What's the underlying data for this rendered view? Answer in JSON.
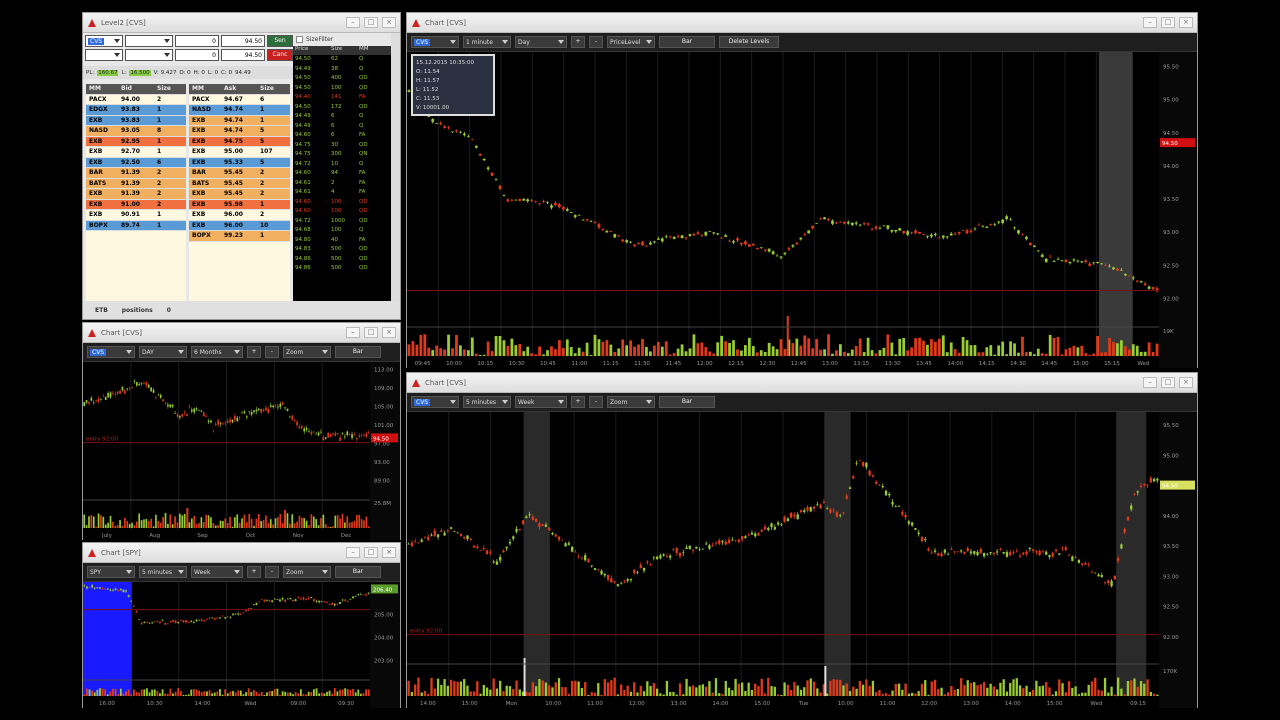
{
  "level2": {
    "title": "Level2 [CVS]",
    "send": "Sen",
    "cancel": "Canc",
    "inputs": [
      "0",
      "94.50",
      "0",
      "94.50"
    ],
    "price_bar": {
      "pl": "160.67",
      "l": "16.500",
      "v": "V: 9.427",
      "o": "O:  0",
      "h": "H:  0",
      "l2": "L:  0",
      "c": "C: 0",
      "last": "94.49"
    },
    "bid_headers": [
      "MM",
      "Bid",
      "Size"
    ],
    "ask_headers": [
      "MM",
      "Ask",
      "Size"
    ],
    "bids": [
      {
        "mm": "PACX",
        "p": "94.00",
        "s": "2",
        "c": "#fff8e0"
      },
      {
        "mm": "EDGX",
        "p": "93.83",
        "s": "1",
        "c": "#5b9bd5"
      },
      {
        "mm": "EXB",
        "p": "93.83",
        "s": "1",
        "c": "#5b9bd5"
      },
      {
        "mm": "NASD",
        "p": "93.05",
        "s": "8",
        "c": "#f0b060"
      },
      {
        "mm": "EXB",
        "p": "92.95",
        "s": "1",
        "c": "#f07040"
      },
      {
        "mm": "EXB",
        "p": "92.70",
        "s": "1",
        "c": "#fff8e0"
      },
      {
        "mm": "EXB",
        "p": "92.50",
        "s": "6",
        "c": "#5b9bd5"
      },
      {
        "mm": "BAR",
        "p": "91.39",
        "s": "2",
        "c": "#f0b060"
      },
      {
        "mm": "BATS",
        "p": "91.39",
        "s": "2",
        "c": "#f0b060"
      },
      {
        "mm": "EXB",
        "p": "91.39",
        "s": "2",
        "c": "#f0b060"
      },
      {
        "mm": "EXB",
        "p": "91.00",
        "s": "2",
        "c": "#f07040"
      },
      {
        "mm": "EXB",
        "p": "90.91",
        "s": "1",
        "c": "#fff8e0"
      },
      {
        "mm": "BOPX",
        "p": "89.74",
        "s": "1",
        "c": "#5b9bd5"
      }
    ],
    "asks": [
      {
        "mm": "PACX",
        "p": "94.67",
        "s": "6",
        "c": "#fff8e0"
      },
      {
        "mm": "NASD",
        "p": "94.74",
        "s": "1",
        "c": "#5b9bd5"
      },
      {
        "mm": "EXB",
        "p": "94.74",
        "s": "1",
        "c": "#f0b060"
      },
      {
        "mm": "EXB",
        "p": "94.74",
        "s": "5",
        "c": "#f0b060"
      },
      {
        "mm": "EXB",
        "p": "94.75",
        "s": "5",
        "c": "#f07040"
      },
      {
        "mm": "EXB",
        "p": "95.00",
        "s": "107",
        "c": "#fff8e0"
      },
      {
        "mm": "EXB",
        "p": "95.33",
        "s": "5",
        "c": "#5b9bd5"
      },
      {
        "mm": "BAR",
        "p": "95.45",
        "s": "2",
        "c": "#f0b060"
      },
      {
        "mm": "BATS",
        "p": "95.45",
        "s": "2",
        "c": "#f0b060"
      },
      {
        "mm": "EXB",
        "p": "95.45",
        "s": "2",
        "c": "#f0b060"
      },
      {
        "mm": "EXB",
        "p": "95.98",
        "s": "1",
        "c": "#f07040"
      },
      {
        "mm": "EXB",
        "p": "96.00",
        "s": "2",
        "c": "#fff8e0"
      },
      {
        "mm": "EXB",
        "p": "96.00",
        "s": "10",
        "c": "#5b9bd5"
      },
      {
        "mm": "BOPX",
        "p": "99.23",
        "s": "1",
        "c": "#f0b060"
      }
    ],
    "sizefilter": "SizeFilter",
    "ts_headers": [
      "Price",
      "Size",
      "MM"
    ],
    "ts": [
      {
        "p": "94.50",
        "s": "62",
        "m": "Q"
      },
      {
        "p": "94.49",
        "s": "38",
        "m": "Q"
      },
      {
        "p": "94.50",
        "s": "400",
        "m": "QD"
      },
      {
        "p": "94.50",
        "s": "100",
        "m": "QD"
      },
      {
        "p": "94.40",
        "s": "141",
        "m": "FA"
      },
      {
        "p": "94.50",
        "s": "172",
        "m": "QD"
      },
      {
        "p": "94.49",
        "s": "6",
        "m": "Q"
      },
      {
        "p": "94.49",
        "s": "6",
        "m": "Q"
      },
      {
        "p": "94.60",
        "s": "6",
        "m": "FA"
      },
      {
        "p": "94.75",
        "s": "30",
        "m": "QD"
      },
      {
        "p": "94.75",
        "s": "300",
        "m": "QN"
      },
      {
        "p": "94.72",
        "s": "10",
        "m": "Q"
      },
      {
        "p": "94.60",
        "s": "94",
        "m": "FA"
      },
      {
        "p": "94.61",
        "s": "2",
        "m": "FA"
      },
      {
        "p": "94.61",
        "s": "4",
        "m": "FA"
      },
      {
        "p": "94.60",
        "s": "100",
        "m": "QD"
      },
      {
        "p": "94.60",
        "s": "100",
        "m": "QD"
      },
      {
        "p": "94.72",
        "s": "1000",
        "m": "QD"
      },
      {
        "p": "94.68",
        "s": "100",
        "m": "Q"
      },
      {
        "p": "94.80",
        "s": "40",
        "m": "FA"
      },
      {
        "p": "94.83",
        "s": "500",
        "m": "QD"
      },
      {
        "p": "94.86",
        "s": "500",
        "m": "QD"
      },
      {
        "p": "94.86",
        "s": "500",
        "m": "QD"
      }
    ],
    "footer_label": "ETB",
    "positions_label": "positions",
    "positions_value": "0"
  },
  "chart_daily": {
    "title": "Chart [CVS]",
    "symbol": "CVS",
    "interval": "DAY",
    "range": "6 Months",
    "zoom": "Zoom",
    "style": "Bar",
    "plus": "+",
    "minus": "-",
    "price_tag": "94.50",
    "axis": [
      "113.00",
      "109.00",
      "105.00",
      "101.00",
      "97.00",
      "93.00",
      "89.00"
    ],
    "vol_axis": "25.8M",
    "months": [
      "July",
      "Aug",
      "Sep",
      "Oct",
      "Nov",
      "Dec"
    ],
    "line_label": "entry 92.00"
  },
  "chart_spy": {
    "title": "Chart [SPY]",
    "symbol": "SPY",
    "interval": "5 minutes",
    "range": "Week",
    "zoom": "Zoom",
    "style": "Bar",
    "plus": "+",
    "minus": "-",
    "price_tag": "206.40",
    "axis": [
      "206.00",
      "205.00",
      "204.00",
      "203.00"
    ],
    "times": [
      "16:00",
      "10:30",
      "14:00",
      "Wed",
      "09:00",
      "09:30"
    ]
  },
  "chart_1min": {
    "title": "Chart [CVS]",
    "symbol": "CVS",
    "interval": "1 minute",
    "range": "Day",
    "plus": "+",
    "minus": "-",
    "price_level": "PriceLevel",
    "style": "Bar",
    "delete_levels": "Delete Levels",
    "tooltip": [
      "15.12.2015 10:35:00",
      "O: 11.54",
      "H: 11.57",
      "L: 11.52",
      "C: 11.53",
      "V: 10001.00"
    ],
    "price_tag": "94.50",
    "axis": [
      "95.50",
      "95.00",
      "94.50",
      "94.00",
      "93.50",
      "93.00",
      "92.50",
      "92.00"
    ],
    "vol_axis": "19K",
    "times": [
      "09:45",
      "10:00",
      "10:15",
      "10:30",
      "10:45",
      "11:00",
      "11:15",
      "11:30",
      "11:45",
      "12:00",
      "12:15",
      "12:30",
      "12:45",
      "13:00",
      "13:15",
      "13:30",
      "13:45",
      "14:00",
      "14:15",
      "14:30",
      "14:45",
      "15:00",
      "15:15",
      "Wed"
    ]
  },
  "chart_5min": {
    "title": "Chart [CVS]",
    "symbol": "CVS",
    "interval": "5 minutes",
    "range": "Week",
    "zoom": "Zoom",
    "style": "Bar",
    "plus": "+",
    "minus": "-",
    "price_tag": "94.50",
    "axis": [
      "95.50",
      "95.00",
      "94.50",
      "94.00",
      "93.50",
      "93.00",
      "92.50",
      "92.00"
    ],
    "vol_axis": "170K",
    "line_label": "entry 92.00",
    "times": [
      "14:00",
      "15:00",
      "Mon",
      "10:00",
      "11:00",
      "12:00",
      "13:00",
      "14:00",
      "15:00",
      "Tue",
      "10:00",
      "11:00",
      "12:00",
      "13:00",
      "14:00",
      "15:00",
      "Wed",
      "09:15"
    ]
  },
  "colors": {
    "up": "#9acd32",
    "down": "#e03a1a",
    "tag": "#d01010",
    "blue": "#2f6ad8"
  }
}
